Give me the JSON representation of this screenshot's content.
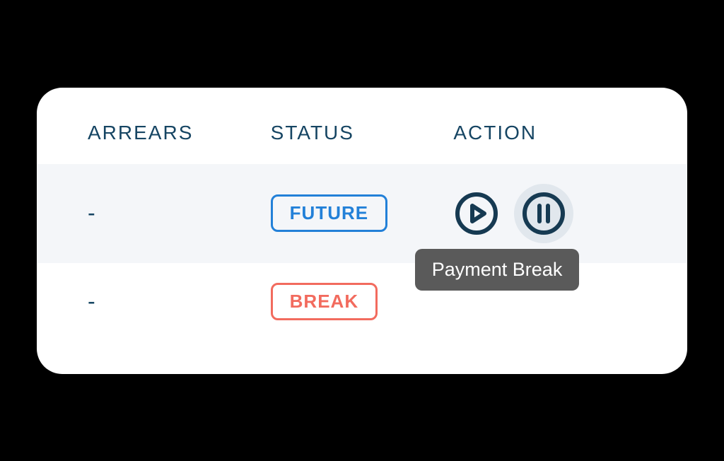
{
  "columns": {
    "arrears": "ARREARS",
    "status": "STATUS",
    "action": "ACTION"
  },
  "rows": [
    {
      "arrears": "-",
      "status_label": "FUTURE",
      "status_type": "future"
    },
    {
      "arrears": "-",
      "status_label": "BREAK",
      "status_type": "break"
    }
  ],
  "tooltip": "Payment Break"
}
